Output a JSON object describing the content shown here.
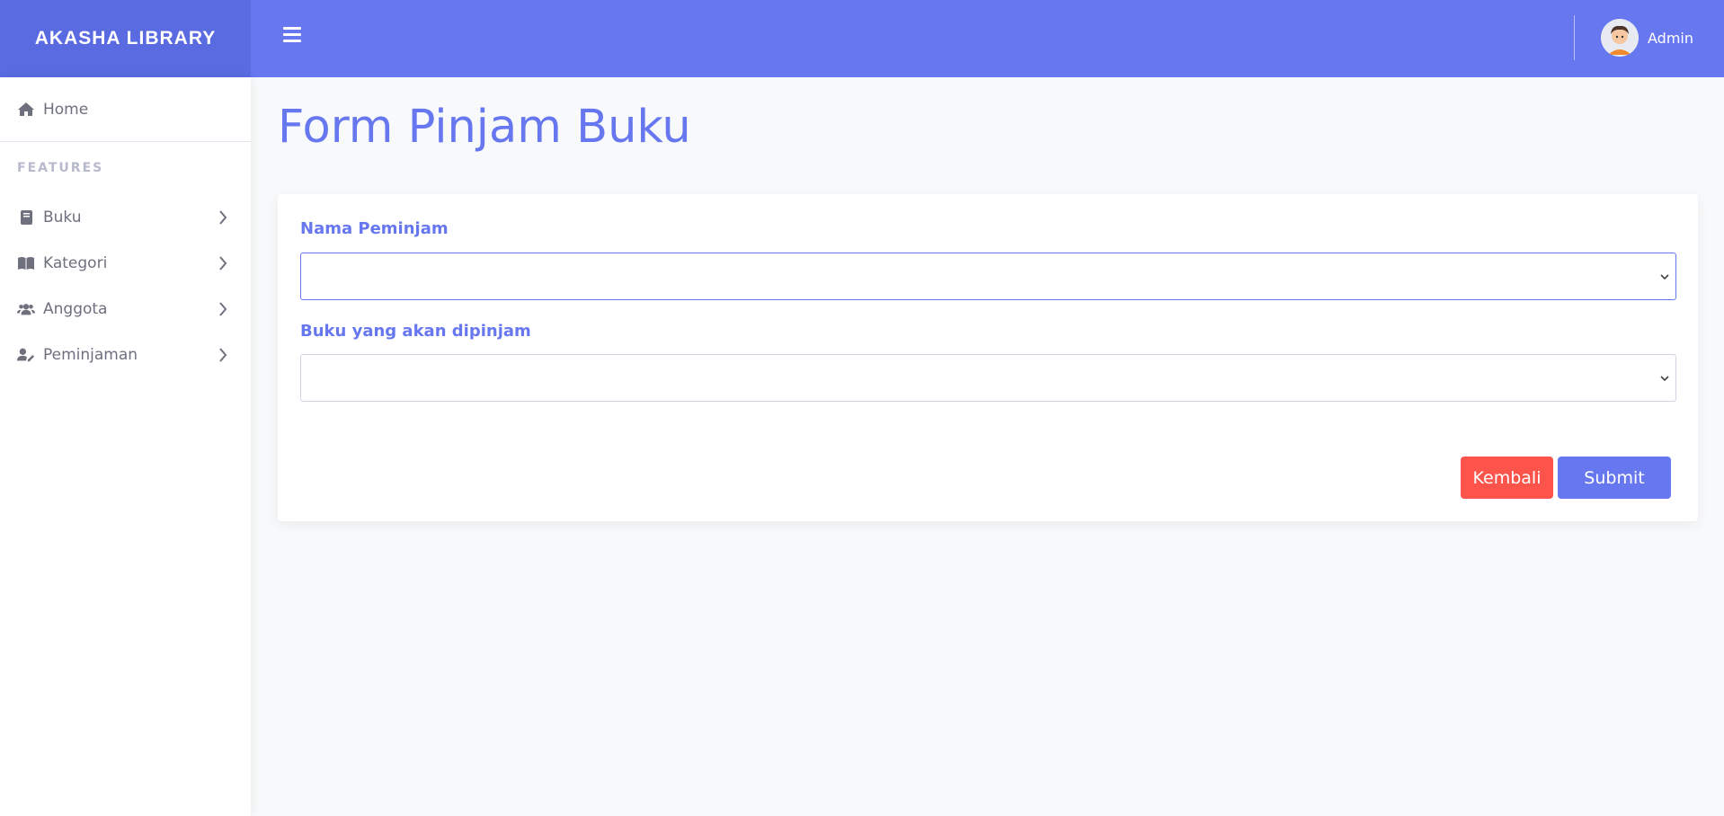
{
  "brand": {
    "title": "AKASHA LIBRARY"
  },
  "topbar": {
    "menu_icon": "hamburger-icon",
    "user_name": "Admin",
    "avatar_icon": "user-avatar"
  },
  "sidebar": {
    "home": {
      "label": "Home",
      "icon": "home-icon"
    },
    "section_title": "FEATURES",
    "items": [
      {
        "label": "Buku",
        "icon": "book-icon"
      },
      {
        "label": "Kategori",
        "icon": "open-book-icon"
      },
      {
        "label": "Anggota",
        "icon": "users-icon"
      },
      {
        "label": "Peminjaman",
        "icon": "user-edit-icon"
      }
    ]
  },
  "page": {
    "title": "Form Pinjam Buku"
  },
  "form": {
    "borrower_label": "Nama Peminjam",
    "borrower_value": "",
    "book_label": "Buku yang akan dipinjam",
    "book_value": "",
    "back_label": "Kembali",
    "submit_label": "Submit"
  },
  "colors": {
    "primary": "#6777ef",
    "brand_bg": "#5a6ae0",
    "danger": "#fc544b",
    "page_bg": "#f8f9fa"
  }
}
